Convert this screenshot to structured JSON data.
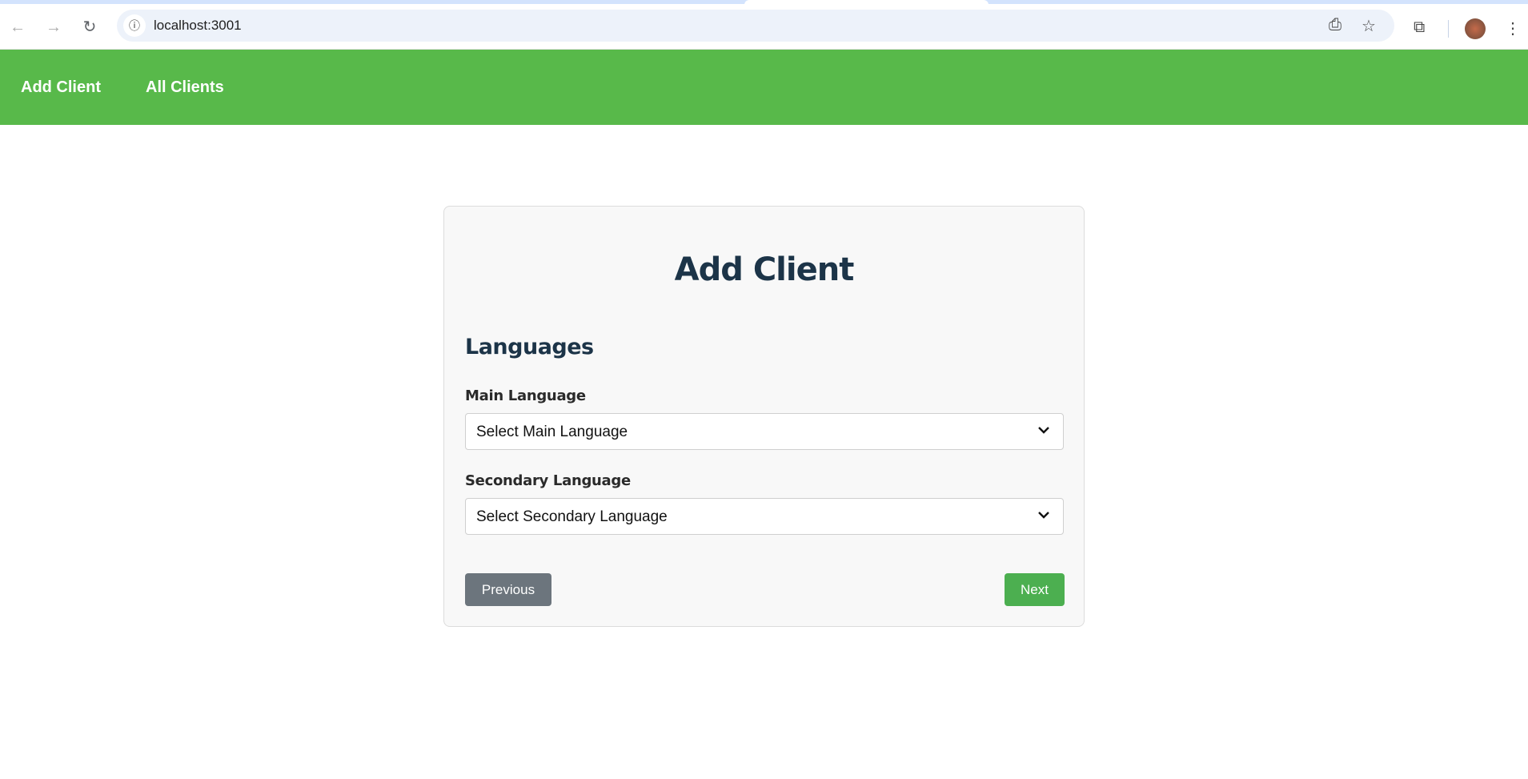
{
  "browser": {
    "url": "localhost:3001",
    "icons": [
      "back-icon",
      "forward-icon",
      "reload-icon",
      "info-icon",
      "install-icon",
      "star-icon",
      "extensions-icon",
      "profile-avatar",
      "more-icon"
    ]
  },
  "nav": {
    "items": [
      {
        "label": "Add Client"
      },
      {
        "label": "All Clients"
      }
    ],
    "color": "#58b94a"
  },
  "form": {
    "title": "Add Client",
    "section": "Languages",
    "main_language": {
      "label": "Main Language",
      "value": "Select Main Language"
    },
    "secondary_language": {
      "label": "Secondary Language",
      "value": "Select Secondary Language"
    },
    "previous_label": "Previous",
    "next_label": "Next"
  }
}
